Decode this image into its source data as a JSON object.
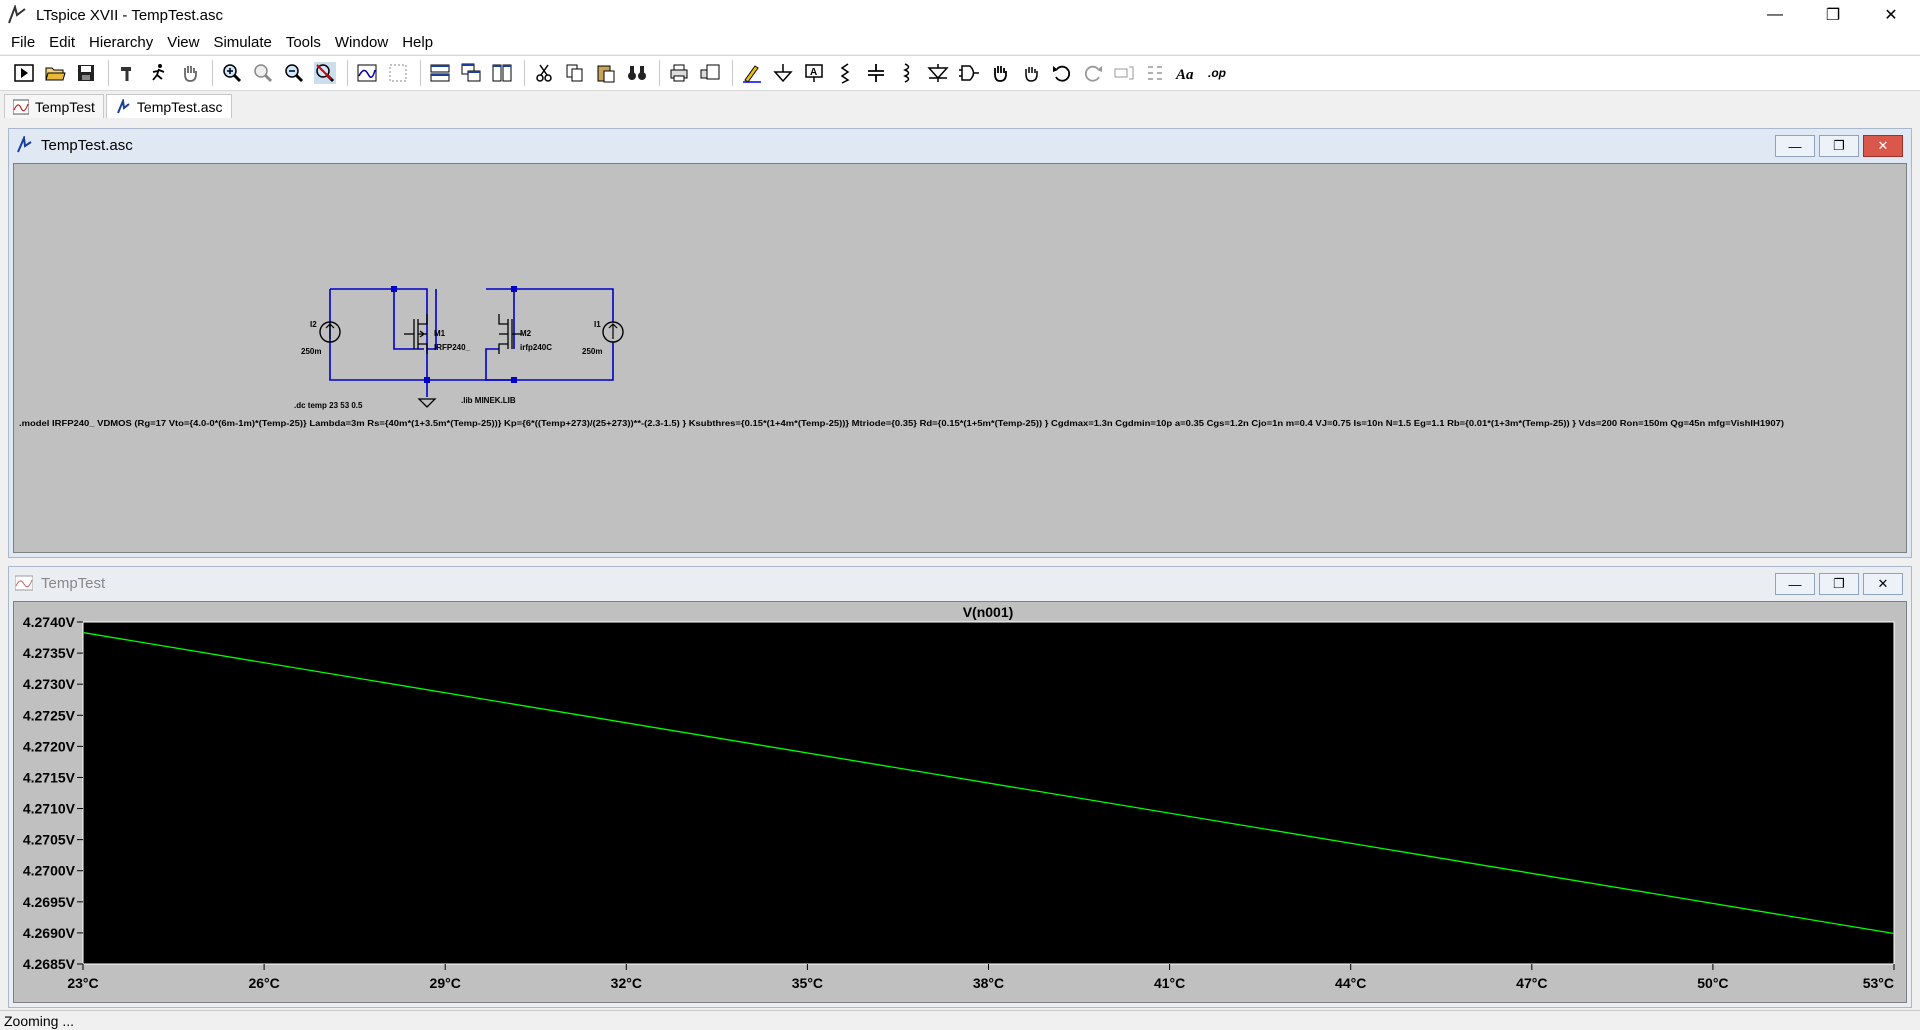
{
  "window": {
    "title": "LTspice XVII - TempTest.asc",
    "minimize": "—",
    "restore": "❐",
    "close": "✕"
  },
  "menu": [
    "File",
    "Edit",
    "Hierarchy",
    "View",
    "Simulate",
    "Tools",
    "Window",
    "Help"
  ],
  "tabs": [
    {
      "label": "TempTest",
      "icon": "waveform-icon"
    },
    {
      "label": "TempTest.asc",
      "icon": "schematic-icon"
    }
  ],
  "toolbar": [
    "run",
    "open",
    "save",
    "control-panel",
    "halt",
    "pan",
    "zoom-in",
    "zoom-fit",
    "zoom-out",
    "zoom-cancel",
    "autorange",
    "mark-unused",
    "tile-horizontal",
    "cascade",
    "tile-vertical",
    "cut",
    "copy",
    "paste",
    "find",
    "print",
    "print-preview",
    "wire",
    "ground",
    "label-net",
    "resistor",
    "capacitor",
    "inductor",
    "diode",
    "component",
    "move",
    "drag",
    "undo",
    "redo",
    "rotate",
    "mirror",
    "text",
    "spice-directive"
  ],
  "schematic": {
    "title": "TempTest.asc",
    "components": {
      "I2": {
        "name": "I2",
        "value": "250m"
      },
      "I1": {
        "name": "I1",
        "value": "250m"
      },
      "M1": {
        "name": "M1",
        "model": "IRFP240_"
      },
      "M2": {
        "name": "M2",
        "model": "irfp240C"
      }
    },
    "directives": {
      "dc": ".dc temp 23 53 0.5",
      "lib": ".lib MINEK.LIB",
      "model": ".model IRFP240_ VDMOS (Rg=17 Vto={4.0-0*(6m-1m)*(Temp-25)} Lambda=3m Rs={40m*(1+3.5m*(Temp-25))} Kp={6*((Temp+273)/(25+273))**-(2.3-1.5) } Ksubthres={0.15*(1+4m*(Temp-25))} Mtriode={0.35} Rd={0.15*(1+5m*(Temp-25)) } Cgdmax=1.3n Cgdmin=10p a=0.35 Cgs=1.2n Cjo=1n m=0.4 VJ=0.75 Is=10n N=1.5 Eg=1.1 Rb={0.01*(1+3m*(Temp-25)) } Vds=200 Ron=150m Qg=45n mfg=VishIH1907)"
    }
  },
  "plot": {
    "title": "TempTest"
  },
  "chart_data": {
    "type": "line",
    "title": "V(n001)",
    "series": [
      {
        "name": "V(n001)",
        "color": "#00ff00",
        "x": [
          23,
          53
        ],
        "y": [
          4.27383,
          4.26899
        ]
      }
    ],
    "xlim": [
      23,
      53
    ],
    "ylim": [
      4.2685,
      4.274
    ],
    "x_ticks": [
      "23°C",
      "26°C",
      "29°C",
      "32°C",
      "35°C",
      "38°C",
      "41°C",
      "44°C",
      "47°C",
      "50°C",
      "53°C"
    ],
    "y_ticks": [
      "4.2740V",
      "4.2735V",
      "4.2730V",
      "4.2725V",
      "4.2720V",
      "4.2715V",
      "4.2710V",
      "4.2705V",
      "4.2700V",
      "4.2695V",
      "4.2690V",
      "4.2685V"
    ],
    "x_tick_values": [
      23,
      26,
      29,
      32,
      35,
      38,
      41,
      44,
      47,
      50,
      53
    ],
    "y_tick_values": [
      4.274,
      4.2735,
      4.273,
      4.2725,
      4.272,
      4.2715,
      4.271,
      4.2705,
      4.27,
      4.2695,
      4.269,
      4.2685
    ],
    "grid": false,
    "background": "#000000"
  },
  "status": {
    "text": "Zooming ..."
  }
}
